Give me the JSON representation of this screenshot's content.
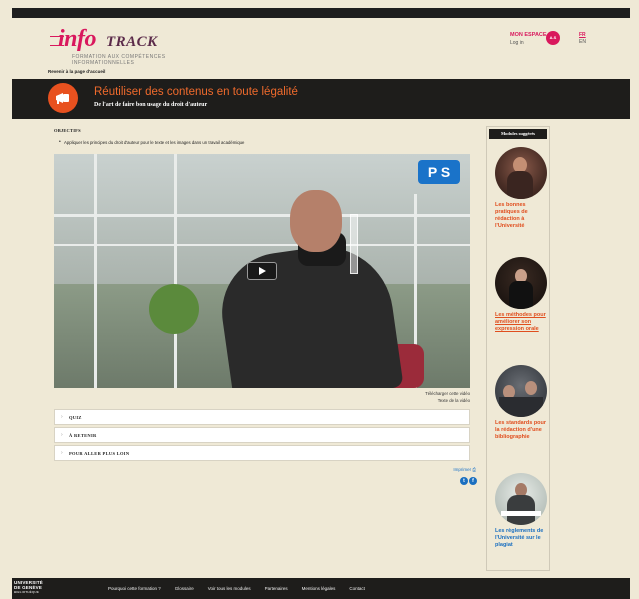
{
  "header": {
    "logo_main": "info",
    "logo_track": "TRACK",
    "logo_sub_1": "FORMATION AUX COMPÉTENCES",
    "logo_sub_2": "INFORMATIONNELLES",
    "myspace_title": "MON ESPACE",
    "login_label": "Log in",
    "avatar_text": "A.S",
    "lang_fr": "FR",
    "lang_en": "EN",
    "back_link": "Revenir à la page d'accueil"
  },
  "banner": {
    "title": "Réutiliser des contenus en toute légalité",
    "subtitle": "De l'art de faire bon usage du droit d'auteur",
    "icon": "megaphone-icon",
    "accent": "#ef6a2c"
  },
  "objectives": {
    "title": "OBJECTIFS",
    "items": [
      "Appliquer les principes du droit d'auteur pour le texte et les images dans un travail académique"
    ]
  },
  "video": {
    "logo_text": "P S",
    "download_label": "Télécharger cette vidéo",
    "text_label": "Texte de la vidéo"
  },
  "accordions": [
    {
      "label": "QUIZ"
    },
    {
      "label": "À RETENIR"
    },
    {
      "label": "POUR ALLER PLUS LOIN"
    }
  ],
  "print_label": "Imprimer",
  "social": [
    "twitter-icon",
    "facebook-icon"
  ],
  "sidebar": {
    "title": "Modules suggérés",
    "modules": [
      {
        "label": "Les bonnes pratiques de rédaction à l'Université",
        "color": "#e04e1e"
      },
      {
        "label": "Les méthodes pour améliorer son expression orale",
        "color": "#e04e1e"
      },
      {
        "label": "Les standards pour la rédaction d'une bibliographie",
        "color": "#e04e1e"
      },
      {
        "label": "Les règlements de l'Université sur le plagiat",
        "color": "#1a6fc0"
      }
    ]
  },
  "footer": {
    "logo_line1": "UNIVERSITÉ",
    "logo_line2": "DE GENÈVE",
    "logo_line3": "BIBLIOTHÈQUE",
    "nav": [
      "Pourquoi cette formation ?",
      "Glossaire",
      "Voir tous les modules",
      "Partenaires",
      "Mentions légales",
      "Contact"
    ]
  },
  "colors": {
    "brand": "#d9185d",
    "background": "#efe9d6",
    "dark": "#1e1d1b"
  }
}
